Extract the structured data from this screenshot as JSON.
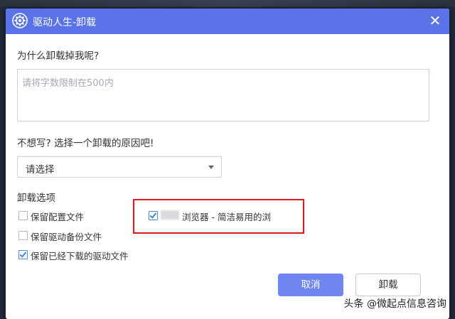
{
  "window": {
    "title": "驱动人生-卸载",
    "title_icon": "gear-icon",
    "close_glyph": "✕"
  },
  "question": {
    "label": "为什么卸载掉我呢?",
    "placeholder": "请将字数限制在500内",
    "value": ""
  },
  "reason": {
    "label": "不想写? 选择一个卸载的原因吧!",
    "selected": "请选择"
  },
  "options": {
    "label": "卸载选项",
    "items": [
      {
        "label": "保留配置文件",
        "checked": false
      },
      {
        "label": "保留驱动备份文件",
        "checked": false
      },
      {
        "label": "保留已经下载的驱动文件",
        "checked": true
      }
    ],
    "promo": {
      "label": "浏览器 - 简洁易用的浏",
      "checked": true
    }
  },
  "buttons": {
    "cancel": "取消",
    "uninstall": "卸载"
  },
  "colors": {
    "titlebar": "#5a73e8",
    "primary_button": "#6f86f2",
    "highlight_border": "#e01a1a",
    "checkbox_check": "#3b86e0"
  },
  "watermark": "头条 @微起点信息咨询"
}
